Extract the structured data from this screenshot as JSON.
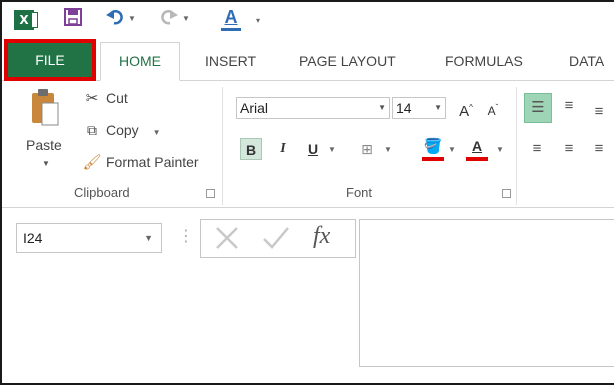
{
  "quick_access": {
    "app_icon": "excel-icon",
    "app_icon_text": "X",
    "save_icon": "save-icon",
    "undo_icon": "undo-icon",
    "redo_icon": "redo-icon",
    "customize_icon": "font-color-icon",
    "customize_letter": "A"
  },
  "tabs": [
    {
      "label": "FILE"
    },
    {
      "label": "HOME"
    },
    {
      "label": "INSERT"
    },
    {
      "label": "PAGE LAYOUT"
    },
    {
      "label": "FORMULAS"
    },
    {
      "label": "DATA"
    }
  ],
  "clipboard": {
    "group_label": "Clipboard",
    "paste_label": "Paste",
    "cut_label": "Cut",
    "copy_label": "Copy",
    "format_painter_label": "Format Painter"
  },
  "font": {
    "group_label": "Font",
    "font_name": "Arial",
    "font_size": "14",
    "bold": "B",
    "italic": "I",
    "underline": "U",
    "grow_font": "A",
    "shrink_font": "A",
    "font_color_letter": "A"
  },
  "formula_bar": {
    "name_box_value": "I24",
    "fx_label": "fx",
    "formula_value": ""
  },
  "colors": {
    "file_tab": "#217346",
    "highlight_outline": "#e00000",
    "accent": "#217346"
  }
}
